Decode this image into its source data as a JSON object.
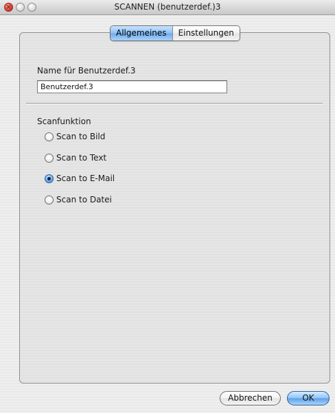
{
  "window": {
    "title": "SCANNEN (benutzerdef.)3"
  },
  "tabs": [
    {
      "label": "Allgemeines",
      "selected": true
    },
    {
      "label": "Einstellungen",
      "selected": false
    }
  ],
  "name_section": {
    "label": "Name für Benutzerdef.3",
    "value": "Benutzerdef.3"
  },
  "scan_section": {
    "label": "Scanfunktion",
    "options": [
      {
        "label": "Scan to Bild",
        "selected": false
      },
      {
        "label": "Scan to Text",
        "selected": false
      },
      {
        "label": "Scan to E-Mail",
        "selected": true
      },
      {
        "label": "Scan to Datei",
        "selected": false
      }
    ]
  },
  "buttons": {
    "cancel": "Abbrechen",
    "ok": "OK"
  },
  "colors": {
    "default_button": "#6fa9ea",
    "selected_tab": "#8dc1f6",
    "close_button": "#e0443a"
  }
}
